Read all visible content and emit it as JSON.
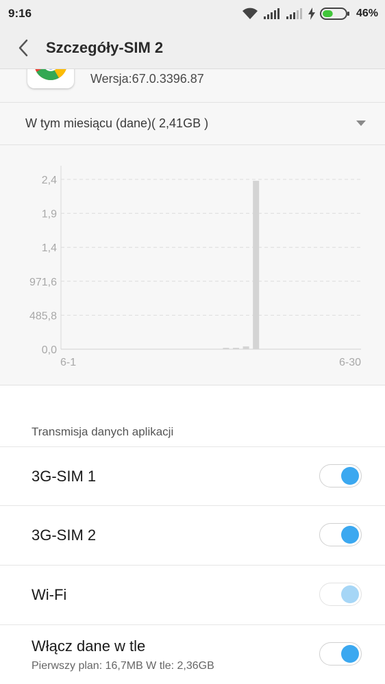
{
  "status_bar": {
    "time": "9:16",
    "battery_percent": "46%",
    "battery_level": 0.46,
    "icons": [
      "wifi-icon",
      "signal-sim1-icon",
      "signal-sim2-icon",
      "charging-bolt-icon",
      "battery-icon"
    ]
  },
  "header": {
    "title": "Szczegóły-SIM 2",
    "back_icon": "chevron-left-icon"
  },
  "app": {
    "icon": "chrome-app-icon",
    "version": "Wersja:67.0.3396.87"
  },
  "usage_period": {
    "label": "W tym miesiącu (dane)( 2,41GB )",
    "dropdown_icon": "caret-down-icon"
  },
  "chart_data": {
    "type": "bar",
    "y_tick_labels": [
      "0,0",
      "485,8",
      "971,6",
      "1,4",
      "1,9",
      "2,4"
    ],
    "ylim": [
      0,
      2.43
    ],
    "x_tick_labels": [
      "6-1",
      "6-30"
    ],
    "x_range": [
      1,
      30
    ],
    "categories": [
      17,
      18,
      19,
      20
    ],
    "values": [
      0.01,
      0.015,
      0.04,
      2.41
    ],
    "grid": true,
    "bar_color": "#d4d4d4"
  },
  "section": {
    "title": "Transmisja danych aplikacji"
  },
  "settings": [
    {
      "label": "3G-SIM 1",
      "sub": "",
      "enabled": true,
      "state": "on"
    },
    {
      "label": "3G-SIM 2",
      "sub": "",
      "enabled": true,
      "state": "on"
    },
    {
      "label": "Wi-Fi",
      "sub": "",
      "enabled": false,
      "state": "on"
    },
    {
      "label": "Włącz dane w tle",
      "sub": "Pierwszy plan: 16,7MB  W tle: 2,36GB",
      "enabled": true,
      "state": "on"
    }
  ],
  "colors": {
    "accent": "#3ba8f0",
    "accent_disabled": "#a6d6f6",
    "battery_green": "#41c63a"
  }
}
